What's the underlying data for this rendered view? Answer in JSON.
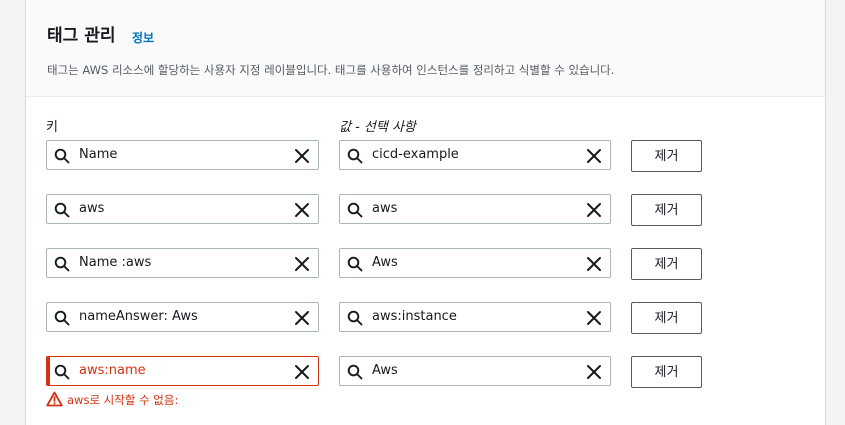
{
  "section": {
    "title": "태그 관리",
    "info_link": "정보",
    "description": "태그는 AWS 리소스에 할당하는 사용자 지정 레이블입니다. 태그를 사용하여 인스턴스를 정리하고 식별할 수 있습니다."
  },
  "columns": {
    "key_label": "키",
    "value_label": "값 - 선택 사항"
  },
  "tags": [
    {
      "key": "Name",
      "value": "cicd-example",
      "remove_label": "제거"
    },
    {
      "key": "aws",
      "value": "aws",
      "remove_label": "제거"
    },
    {
      "key": "Name :aws",
      "value": "Aws",
      "remove_label": "제거"
    },
    {
      "key": "nameAnswer: Aws",
      "value": "aws:instance",
      "remove_label": "제거"
    },
    {
      "key": "aws:name",
      "value": "Aws",
      "remove_label": "제거",
      "error": true
    }
  ],
  "error_message": "aws로 시작할 수 없음:",
  "colors": {
    "error": "#d13212",
    "link": "#0073bb",
    "border": "#aab7b8"
  },
  "icons": {
    "search": "search-icon",
    "clear": "close-icon",
    "warning": "warning-icon"
  }
}
